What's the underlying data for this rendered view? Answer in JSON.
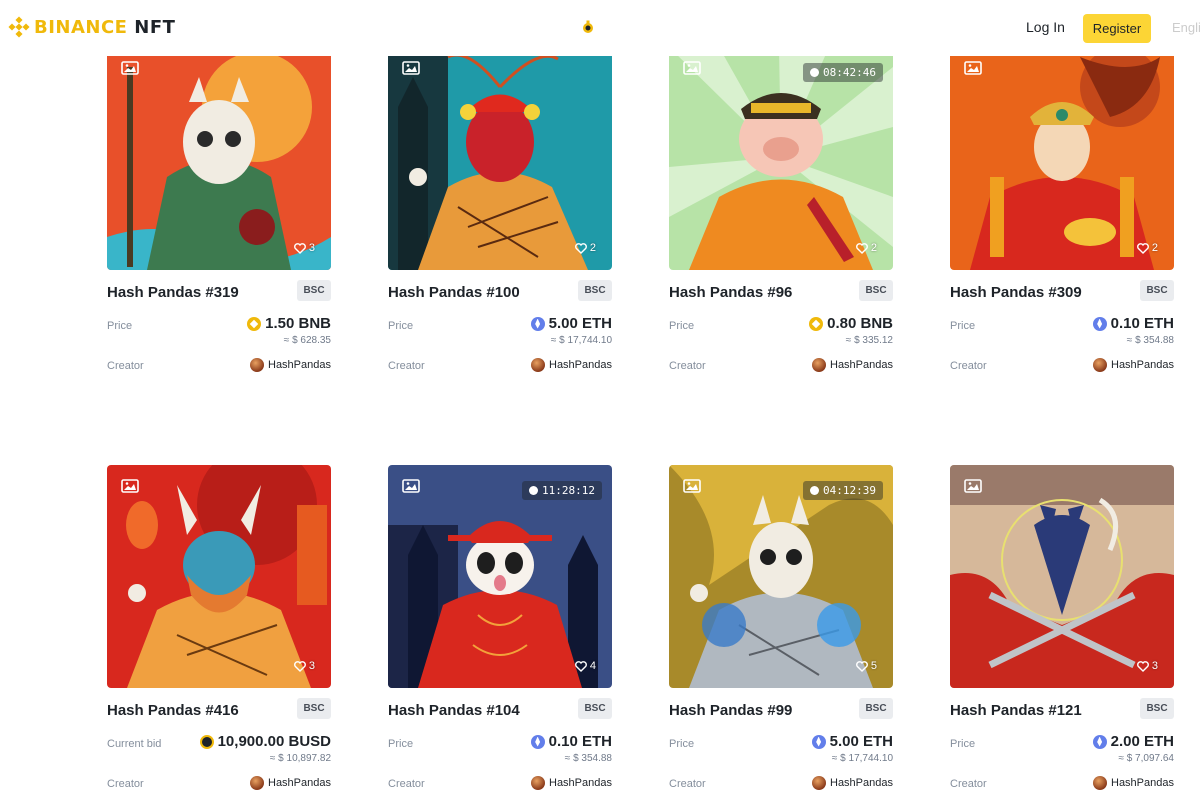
{
  "header": {
    "logo_brand": "BINANCE",
    "logo_product": "NFT",
    "login_label": "Log In",
    "register_label": "Register",
    "language_label": "English"
  },
  "cards": [
    {
      "title": "Hash Pandas #319",
      "chain": "BSC",
      "price_label": "Price",
      "price": "1.50 BNB",
      "currency": "bnb",
      "usd": "≈ $ 628.35",
      "creator_label": "Creator",
      "creator": "HashPandas",
      "likes": "3",
      "timer": ""
    },
    {
      "title": "Hash Pandas #100",
      "chain": "BSC",
      "price_label": "Price",
      "price": "5.00 ETH",
      "currency": "eth",
      "usd": "≈ $ 17,744.10",
      "creator_label": "Creator",
      "creator": "HashPandas",
      "likes": "2",
      "timer": ""
    },
    {
      "title": "Hash Pandas #96",
      "chain": "BSC",
      "price_label": "Price",
      "price": "0.80 BNB",
      "currency": "bnb",
      "usd": "≈ $ 335.12",
      "creator_label": "Creator",
      "creator": "HashPandas",
      "likes": "2",
      "timer": "08:42:46"
    },
    {
      "title": "Hash Pandas #309",
      "chain": "BSC",
      "price_label": "Price",
      "price": "0.10 ETH",
      "currency": "eth",
      "usd": "≈ $ 354.88",
      "creator_label": "Creator",
      "creator": "HashPandas",
      "likes": "2",
      "timer": ""
    },
    {
      "title": "Hash Pandas #416",
      "chain": "BSC",
      "price_label": "Current bid",
      "price": "10,900.00 BUSD",
      "currency": "busd",
      "usd": "≈ $ 10,897.82",
      "creator_label": "Creator",
      "creator": "HashPandas",
      "likes": "3",
      "timer": ""
    },
    {
      "title": "Hash Pandas #104",
      "chain": "BSC",
      "price_label": "Price",
      "price": "0.10 ETH",
      "currency": "eth",
      "usd": "≈ $ 354.88",
      "creator_label": "Creator",
      "creator": "HashPandas",
      "likes": "4",
      "timer": "11:28:12"
    },
    {
      "title": "Hash Pandas #99",
      "chain": "BSC",
      "price_label": "Price",
      "price": "5.00 ETH",
      "currency": "eth",
      "usd": "≈ $ 17,744.10",
      "creator_label": "Creator",
      "creator": "HashPandas",
      "likes": "5",
      "timer": "04:12:39"
    },
    {
      "title": "Hash Pandas #121",
      "chain": "BSC",
      "price_label": "Price",
      "price": "2.00 ETH",
      "currency": "eth",
      "usd": "≈ $ 7,097.64",
      "creator_label": "Creator",
      "creator": "HashPandas",
      "likes": "3",
      "timer": ""
    }
  ]
}
